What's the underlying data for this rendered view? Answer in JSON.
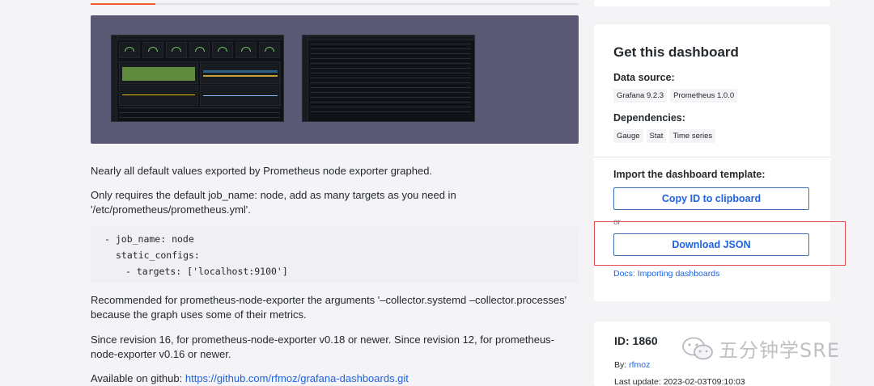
{
  "description": {
    "p1": "Nearly all default values exported by Prometheus node exporter graphed.",
    "p2a": "Only requires the default job_name: node, add as many targets as you need in",
    "p2b": "'/etc/prometheus/prometheus.yml'.",
    "code_line1": "- job_name: node",
    "code_line2": "static_configs:",
    "code_line3": "- targets: ['localhost:9100']",
    "p3a": "Recommended for prometheus-node-exporter the arguments '–collector.systemd –collector.processes'",
    "p3b": "because the graph uses some of their metrics.",
    "p4a": "Since revision 16, for prometheus-node-exporter v0.18 or newer. Since revision 12, for prometheus-",
    "p4b": "node-exporter v0.16 or newer.",
    "github_prefix": "Available on github:",
    "github_link": "https://github.com/rfmoz/grafana-dashboards.git"
  },
  "get_dashboard": {
    "title": "Get this dashboard",
    "datasource_heading": "Data source:",
    "datasources": [
      "Grafana 9.2.3",
      "Prometheus 1.0.0"
    ],
    "dependencies_heading": "Dependencies:",
    "dependencies": [
      "Gauge",
      "Stat",
      "Time series"
    ],
    "import_heading": "Import the dashboard template:",
    "copy_button": "Copy ID to clipboard",
    "or_text": "or",
    "download_button": "Download JSON",
    "docs_link": "Docs: Importing dashboards"
  },
  "info": {
    "id": "ID: 1860",
    "by_prefix": "By:",
    "author": "rfmoz",
    "last_update": "Last update: 2023-02-03T09:10:03"
  },
  "watermark": {
    "text": "五分钟学SRE",
    "icon": "wechat-icon"
  },
  "colors": {
    "accent": "#1f62e0",
    "highlight": "#e24b4b",
    "gallery_bg": "#5a5872",
    "tab_active": "#f05a28"
  }
}
